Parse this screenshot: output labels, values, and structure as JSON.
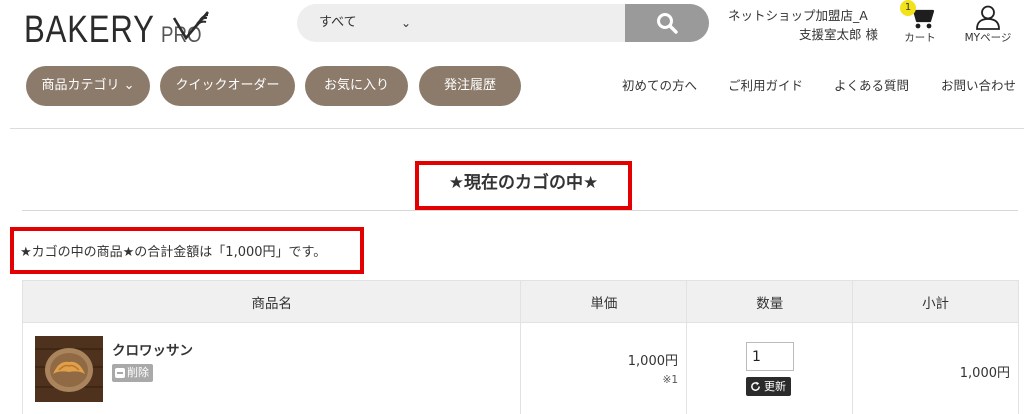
{
  "header": {
    "logo_main": "BAKERY",
    "logo_sub": "PRO",
    "search": {
      "category": "すべて",
      "query": ""
    },
    "shop_name": "ネットショップ加盟店_A",
    "user_name": "支援室太郎 様",
    "cart": {
      "label": "カート",
      "count": "1"
    },
    "mypage_label": "MYページ"
  },
  "nav": {
    "buttons": [
      "商品カテゴリ ⌄",
      "クイックオーダー",
      "お気に入り",
      "発注履歴"
    ],
    "links": [
      "初めての方へ",
      "ご利用ガイド",
      "よくある質問",
      "お問い合わせ"
    ]
  },
  "main": {
    "heading": "★現在のカゴの中★",
    "summary": "★カゴの中の商品★の合計金額は「1,000円」です。",
    "table": {
      "headers": [
        "商品名",
        "単価",
        "数量",
        "小計"
      ],
      "rows": [
        {
          "name": "クロワッサン",
          "delete_label": "削除",
          "price": "1,000円",
          "note": "※1",
          "quantity": "1",
          "update_label": "更新",
          "subtotal": "1,000円"
        }
      ]
    }
  },
  "colors": {
    "nav_button": "#8c7b6b",
    "highlight_border": "#e30000",
    "search_button": "#9a9a9a",
    "cart_badge": "#f3e21a"
  }
}
